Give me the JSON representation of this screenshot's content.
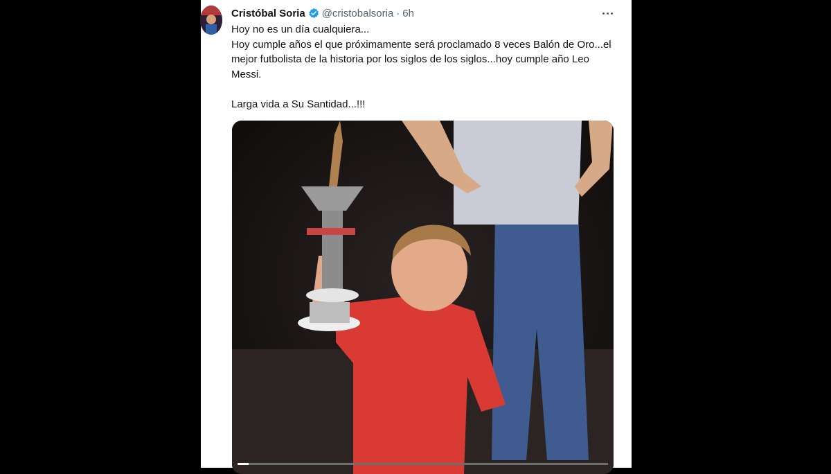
{
  "tweet": {
    "author_name": "Cristóbal Soria",
    "verified_icon": "verified-badge-icon",
    "handle": "@cristobalsoria",
    "separator": "·",
    "time": "6h",
    "more_icon": "more-options-icon",
    "text": "Hoy no es un día cualquiera...\nHoy cumple años el que próximamente será proclamado 8 veces Balón de Oro...el mejor futbolista de la historia por los siglos de los siglos...hoy cumple año Leo Messi.\n\nLarga vida a Su Santidad...!!!"
  },
  "media": {
    "progress_percent": 3
  },
  "colors": {
    "accent": "#1d9bf0",
    "text": "#0f1419",
    "secondary": "#536471",
    "background": "#ffffff"
  }
}
